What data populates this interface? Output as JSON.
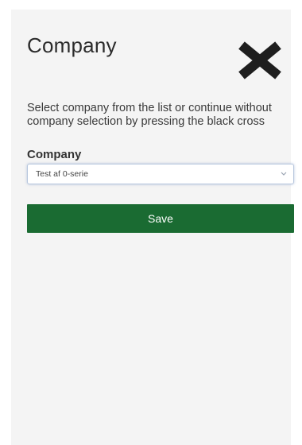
{
  "dialog": {
    "title": "Company",
    "instruction": "Select company from the list or continue without company selection by pressing the black cross",
    "close_icon": "close-icon",
    "field_label": "Company",
    "select": {
      "selected_value": "Test af 0-serie"
    },
    "save_label": "Save"
  },
  "colors": {
    "save_button": "#1a6b32",
    "panel_background": "#f4f4f4",
    "close_icon": "#1e1e1e"
  }
}
